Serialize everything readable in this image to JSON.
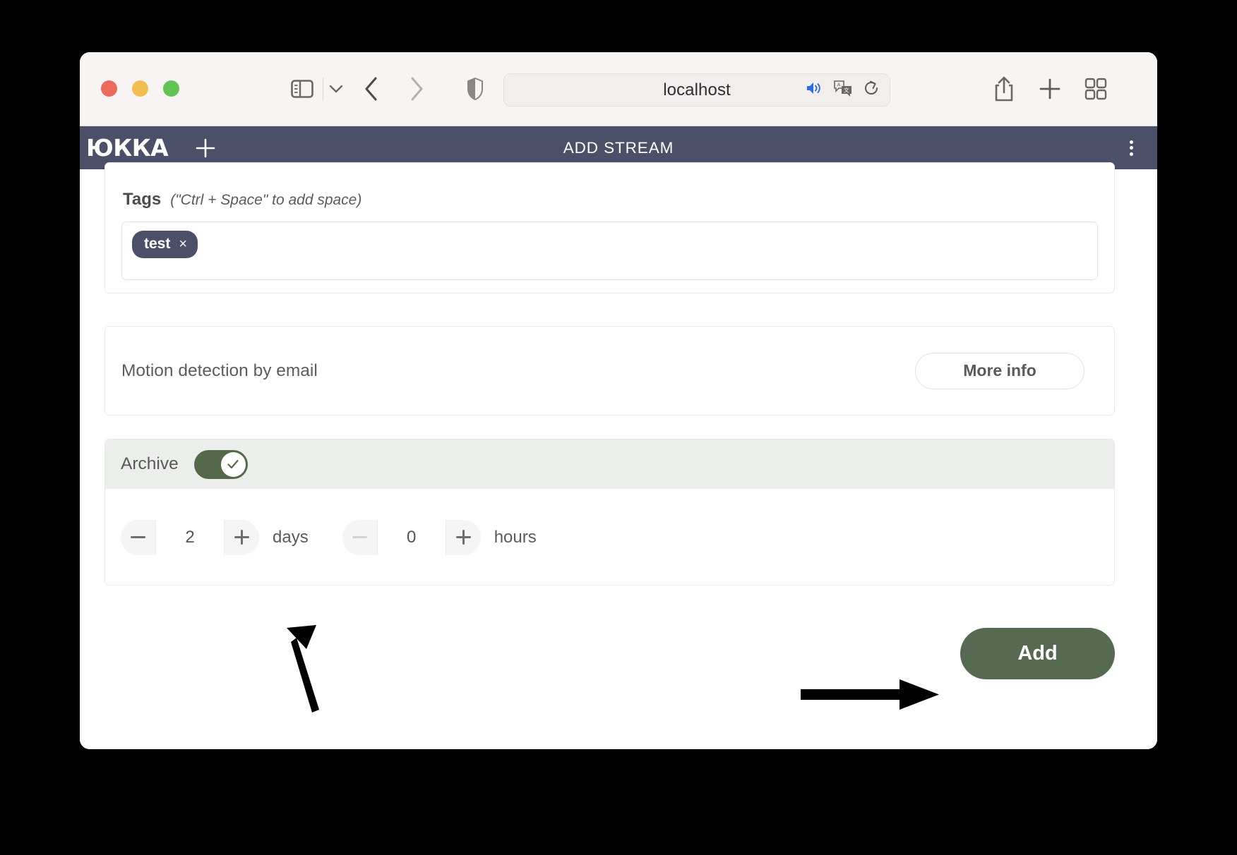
{
  "browser": {
    "url": "localhost",
    "traffic_lights": [
      "close",
      "minimize",
      "zoom"
    ],
    "icons": {
      "sidebar": "sidebar-toggle-icon",
      "sidebar_chevron": "chevron-down-icon",
      "back": "back-chevron-icon",
      "forward": "forward-chevron-icon",
      "shield": "privacy-shield-icon",
      "audio": "speaker-playing-icon",
      "translate": "translate-icon",
      "reload": "reload-icon",
      "share": "share-icon",
      "new_tab": "plus-icon",
      "tab_overview": "tab-grid-icon"
    }
  },
  "app_header": {
    "logo": "ЮККА",
    "add_label": "+",
    "title": "ADD STREAM",
    "menu": "kebab-menu-icon",
    "background": "#4b4f68"
  },
  "tags_section": {
    "label": "Tags",
    "hint": "(\"Ctrl + Space\" to add space)",
    "chips": [
      {
        "label": "test",
        "remove": "×"
      }
    ]
  },
  "motion_section": {
    "label": "Motion detection by email",
    "more_info_label": "More info"
  },
  "archive_section": {
    "label": "Archive",
    "toggle_on": true,
    "toggle_color": "#54684c",
    "steppers": [
      {
        "name": "days",
        "value": "2",
        "unit": "days",
        "minus": "−",
        "plus": "+",
        "minus_disabled": false
      },
      {
        "name": "hours",
        "value": "0",
        "unit": "hours",
        "minus": "−",
        "plus": "+",
        "minus_disabled": true
      }
    ]
  },
  "footer": {
    "add_label": "Add",
    "add_color": "#566a51"
  },
  "annotations": [
    {
      "name": "arrow-to-days-stepper",
      "direction": "up-left"
    },
    {
      "name": "arrow-to-add-button",
      "direction": "right"
    }
  ]
}
